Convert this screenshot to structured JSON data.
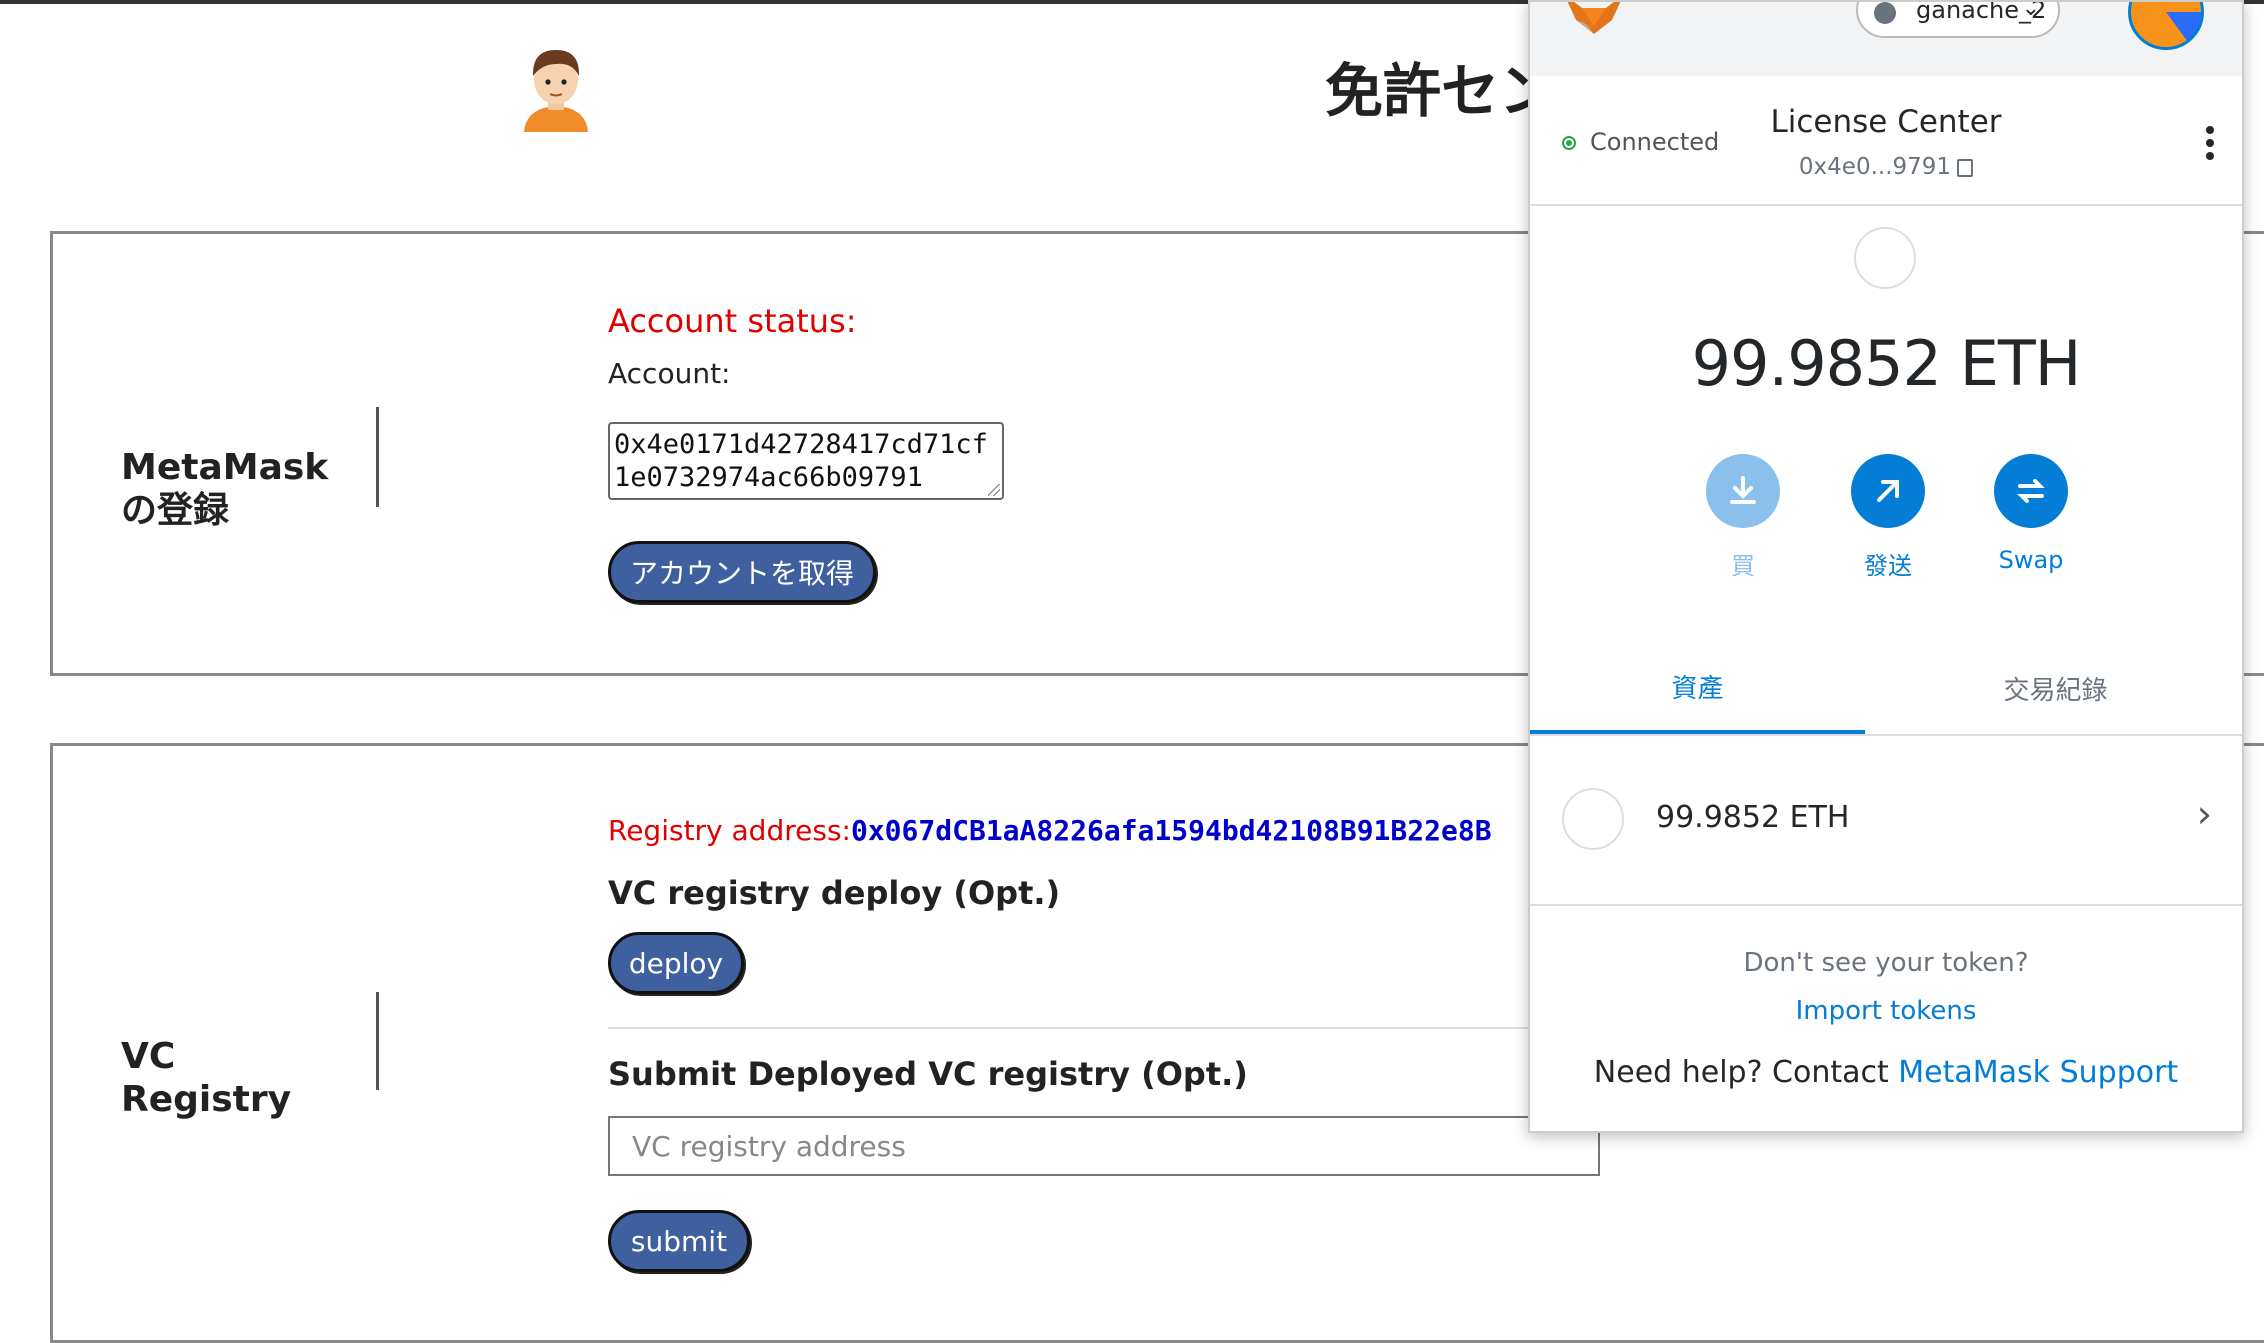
{
  "page": {
    "title": "免許セン",
    "avatar_icon": "person-avatar-icon"
  },
  "metamask_section": {
    "label_line1": "MetaMask",
    "label_line2": "の登録",
    "status_label": "Account status:",
    "account_label": "Account:",
    "account_value": "0x4e0171d42728417cd71cf1e0732974ac66b09791",
    "get_account_button": "アカウントを取得"
  },
  "vc_section": {
    "label_line1": "VC",
    "label_line2": "Registry",
    "registry_label": "Registry address:",
    "registry_value": "0x067dCB1aA8226afa1594bd42108B91B22e8B",
    "deploy_heading": "VC registry deploy (Opt.)",
    "deploy_button": "deploy",
    "submit_heading": "Submit Deployed VC registry (Opt.)",
    "address_placeholder": "VC registry address",
    "submit_button": "submit"
  },
  "metamask_popup": {
    "network": "ganache_2",
    "connection_status": "Connected",
    "site_name": "License Center",
    "account_short": "0x4e0...9791",
    "balance": "99.9852 ETH",
    "actions": [
      {
        "label": "買",
        "icon": "download-icon"
      },
      {
        "label": "發送",
        "icon": "arrow-up-right-icon"
      },
      {
        "label": "Swap",
        "icon": "swap-icon"
      }
    ],
    "tabs": [
      "資產",
      "交易紀錄"
    ],
    "asset_row": "99.9852 ETH",
    "no_token_text": "Don't see your token?",
    "import_link": "Import tokens",
    "help_prefix": "Need help? Contact ",
    "help_link": "MetaMask Support",
    "colors": {
      "accent": "#037dd6",
      "connected": "#28a745",
      "button_bg": "#3f5f9e",
      "error": "#e00000",
      "address": "#0000cc"
    }
  }
}
